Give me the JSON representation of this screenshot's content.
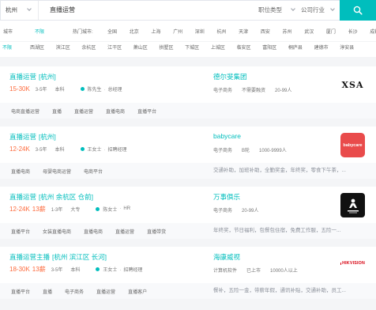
{
  "colors": {
    "accent": "#00bebd",
    "salary": "#fe6a3c",
    "page_bg": "#f4f5f7",
    "tag_row_bg": "#f8f9fb",
    "babycare_logo": "#e94b4b",
    "hikvision_logo": "#d7000f"
  },
  "search": {
    "city": "杭州",
    "query": "直播运营",
    "job_type": "职位类型",
    "industry": "公司行业",
    "button_icon": "search-icon"
  },
  "city_filter": {
    "label": "城市",
    "selected": "不限",
    "hot_label": "热门城市:",
    "cities": [
      "全国",
      "北京",
      "上海",
      "广州",
      "深圳",
      "杭州",
      "天津",
      "西安",
      "苏州",
      "武汉",
      "厦门",
      "长沙",
      "成都"
    ]
  },
  "district_filter": {
    "items": [
      "不限",
      "西湖区",
      "滨江区",
      "余杭区",
      "江干区",
      "萧山区",
      "拱墅区",
      "下城区",
      "上城区",
      "临安区",
      "富阳区",
      "桐庐县",
      "建德市",
      "淳安县"
    ]
  },
  "jobs": [
    {
      "title": "直播运营",
      "location": "[杭州]",
      "salary": "15-30K",
      "experience": "3-5年",
      "education": "本科",
      "recruiter": {
        "name": "陈先生",
        "role": "总经理"
      },
      "company": {
        "name": "德尔斐集团",
        "industry": "电子商务",
        "stage": "不需要融资",
        "size": "20-99人"
      },
      "logo": {
        "text": "XSA"
      },
      "tags": [
        "电商直播运营",
        "直播",
        "直播运营",
        "直播电商",
        "直播平台"
      ]
    },
    {
      "title": "直播运营",
      "location": "[杭州]",
      "salary": "12-24K",
      "experience": "3-5年",
      "education": "本科",
      "recruiter": {
        "name": "王女士",
        "role": "招聘经理"
      },
      "company": {
        "name": "babycare",
        "industry": "电子商务",
        "stage": "B轮",
        "size": "1000-9999人"
      },
      "logo": {
        "text": "babycare"
      },
      "tags": [
        "直播电商",
        "母婴电商运营",
        "电商平台"
      ],
      "benefits": "交通补助，加班补助，全勤奖金，年终奖，零食下午茶，..."
    },
    {
      "title": "直播运营",
      "location": "[杭州 余杭区 仓前]",
      "salary": "12-24K",
      "salary_months": "13薪",
      "experience": "1-3年",
      "education": "大专",
      "recruiter": {
        "name": "陈女士",
        "role": "HR"
      },
      "company": {
        "name": "万事俱乐",
        "industry": "电子商务",
        "size": "20-99人"
      },
      "tags": [
        "直播平台",
        "女装直播电商",
        "直播电商",
        "直播运营",
        "直播带货"
      ],
      "benefits": "年终奖，节日福利，包餐包住宿，免费工作服，五险一..."
    },
    {
      "title": "直播运营主播",
      "location": "[杭州 滨江区 长河]",
      "salary": "18-30K",
      "salary_months": "13薪",
      "experience": "3-5年",
      "education": "本科",
      "recruiter": {
        "name": "王女士",
        "role": "招聘经理"
      },
      "company": {
        "name": "海康威视",
        "industry": "计算机软件",
        "stage": "已上市",
        "size": "10000人以上"
      },
      "logo": {
        "text": "HIKVISION"
      },
      "tags": [
        "直播平台",
        "直播",
        "电子商务",
        "直播运营",
        "直播客户"
      ],
      "benefits": "餐补，五险一金，带薪年假，通讯补贴，交通补助，员工..."
    }
  ]
}
